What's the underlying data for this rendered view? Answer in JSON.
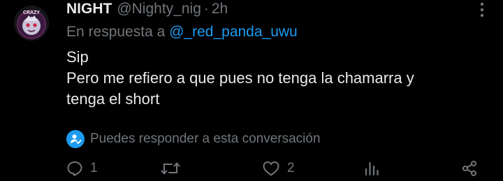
{
  "tweet": {
    "author_name": "NIGHT",
    "handle": "@Nighty_nig",
    "separator": "·",
    "time": "2h",
    "replying_prefix": "En respuesta a",
    "replying_to": "@_red_panda_uwu",
    "body_lines": [
      "Sip",
      "Pero me refiero a que pues no tenga la chamarra y",
      "tenga el short"
    ],
    "avatar_text": "CRAZY",
    "reply_notice": "Puedes responder a esta conversación"
  },
  "actions": {
    "reply_count": "1",
    "retweet_count": "",
    "like_count": "2"
  },
  "icons": {
    "more": "more-dots-icon",
    "notice": "user-check-icon",
    "reply": "reply-icon",
    "retweet": "retweet-icon",
    "like": "heart-icon",
    "views": "views-chart-icon",
    "share": "share-icon"
  },
  "colors": {
    "background": "#000000",
    "primary_text": "#e7e9ea",
    "secondary_text": "#71767b",
    "accent": "#1d9bf0"
  }
}
